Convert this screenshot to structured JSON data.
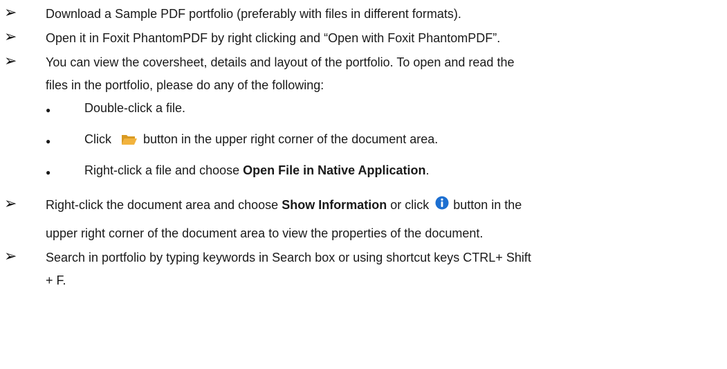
{
  "items": [
    {
      "text": "Download a Sample PDF portfolio (preferably with files in different formats)."
    },
    {
      "text": "Open it in Foxit PhantomPDF by right clicking and “Open with Foxit PhantomPDF”."
    },
    {
      "line1": "You can view the coversheet, details and layout of the portfolio. To open and read the",
      "line2": "files in the portfolio, please do any of the following:"
    },
    {
      "pre": "Right-click the document area and choose ",
      "bold": "Show Information",
      "mid": " or click ",
      "post": "button in the",
      "line2": "upper right corner of the document area to view the properties of the document."
    },
    {
      "line1": "Search in portfolio by typing keywords in Search box or using shortcut keys CTRL+ Shift",
      "line2": "+ F."
    }
  ],
  "subitems": [
    {
      "text": "Double-click a file."
    },
    {
      "pre": "Click",
      "post": "button in the upper right corner of the document area."
    },
    {
      "pre": "Right-click a file and choose ",
      "bold": "Open File in Native Application",
      "post": "."
    }
  ],
  "icons": {
    "arrow": "➢",
    "bullet": "●",
    "folder": "folder-open-icon",
    "info": "info-icon"
  },
  "colors": {
    "folder": "#f2b33d",
    "info": "#1c6fd1"
  }
}
